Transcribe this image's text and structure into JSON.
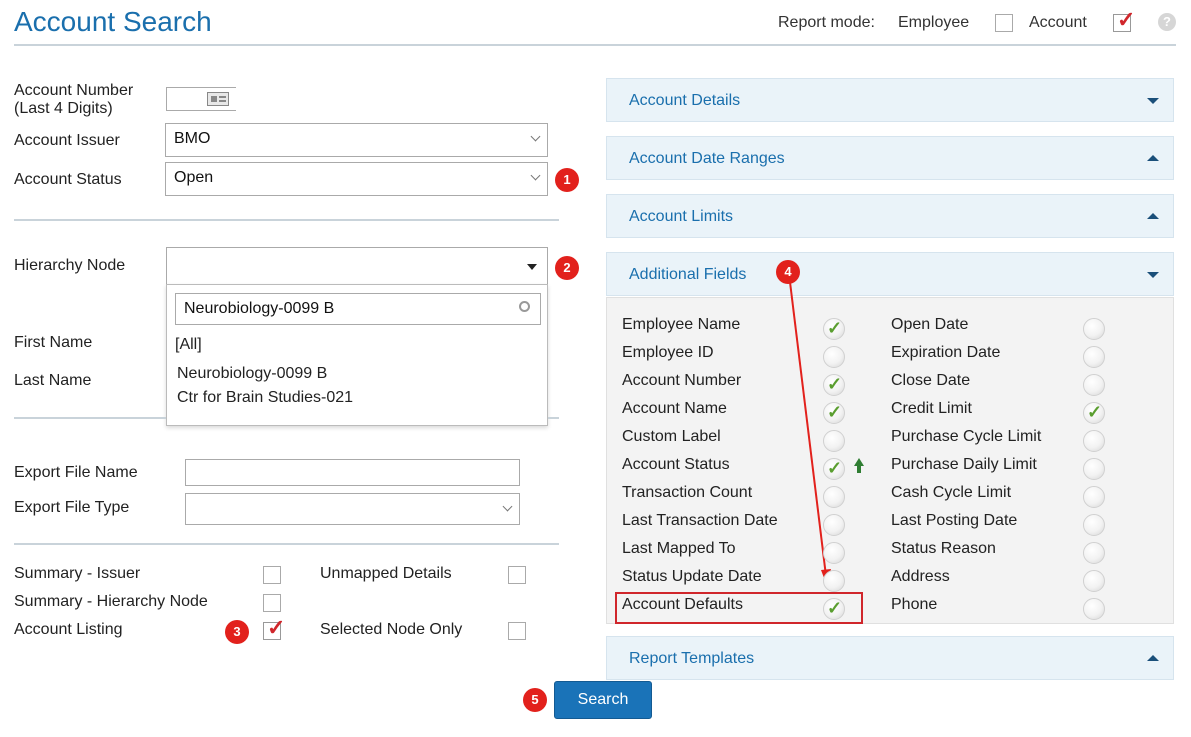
{
  "header": {
    "title": "Account Search",
    "report_mode_label": "Report mode:",
    "mode_employee": "Employee",
    "mode_account": "Account",
    "mode_account_checked": true,
    "mode_employee_checked": false,
    "help_icon": "question-circle-icon"
  },
  "form": {
    "account_number_label_1": "Account Number",
    "account_number_label_2": "(Last 4 Digits)",
    "account_issuer_label": "Account Issuer",
    "account_issuer_value": "BMO",
    "account_status_label": "Account Status",
    "account_status_value": "Open",
    "hierarchy_node_label": "Hierarchy Node",
    "hierarchy_node_value": "",
    "first_name_label": "First Name",
    "last_name_label": "Last Name",
    "export_file_name_label": "Export File Name",
    "export_file_name_value": "",
    "export_file_type_label": "Export File Type",
    "export_file_type_value": ""
  },
  "hierarchy_dropdown": {
    "search_value": "Neurobiology-0099 B",
    "options": [
      "[All]",
      "Neurobiology-0099 B",
      "Ctr for Brain Studies-021"
    ]
  },
  "options": {
    "summary_issuer": {
      "label": "Summary - Issuer",
      "checked": false
    },
    "summary_hierarchy": {
      "label": "Summary - Hierarchy Node",
      "checked": false
    },
    "account_listing": {
      "label": "Account Listing",
      "checked": true
    },
    "unmapped_details": {
      "label": "Unmapped Details",
      "checked": false
    },
    "selected_node_only": {
      "label": "Selected Node Only",
      "checked": false
    }
  },
  "badges": [
    "1",
    "2",
    "3",
    "4",
    "5"
  ],
  "panels": {
    "account_details": "Account Details",
    "account_date_ranges": "Account Date Ranges",
    "account_limits": "Account Limits",
    "additional_fields": "Additional Fields",
    "report_templates": "Report Templates"
  },
  "additional_fields": {
    "left": [
      {
        "label": "Employee Name",
        "checked": true
      },
      {
        "label": "Employee ID",
        "checked": false
      },
      {
        "label": "Account Number",
        "checked": true
      },
      {
        "label": "Account Name",
        "checked": true
      },
      {
        "label": "Custom Label",
        "checked": false
      },
      {
        "label": "Account Status",
        "checked": true
      },
      {
        "label": "Transaction Count",
        "checked": false
      },
      {
        "label": "Last Transaction Date",
        "checked": false
      },
      {
        "label": "Last Mapped To",
        "checked": false
      },
      {
        "label": "Status Update Date",
        "checked": false
      },
      {
        "label": "Account Defaults",
        "checked": true
      }
    ],
    "right": [
      {
        "label": "Open Date",
        "checked": false
      },
      {
        "label": "Expiration Date",
        "checked": false
      },
      {
        "label": "Close Date",
        "checked": false
      },
      {
        "label": "Credit Limit",
        "checked": true
      },
      {
        "label": "Purchase Cycle Limit",
        "checked": false
      },
      {
        "label": "Purchase Daily Limit",
        "checked": false
      },
      {
        "label": "Cash Cycle Limit",
        "checked": false
      },
      {
        "label": "Last Posting Date",
        "checked": false
      },
      {
        "label": "Status Reason",
        "checked": false
      },
      {
        "label": "Address",
        "checked": false
      },
      {
        "label": "Phone",
        "checked": false
      }
    ]
  },
  "search_button": "Search",
  "colors": {
    "accent": "#1a6fad",
    "badge": "#e2211c",
    "check": "#5a9e2f",
    "tick_red": "#d0262b"
  }
}
